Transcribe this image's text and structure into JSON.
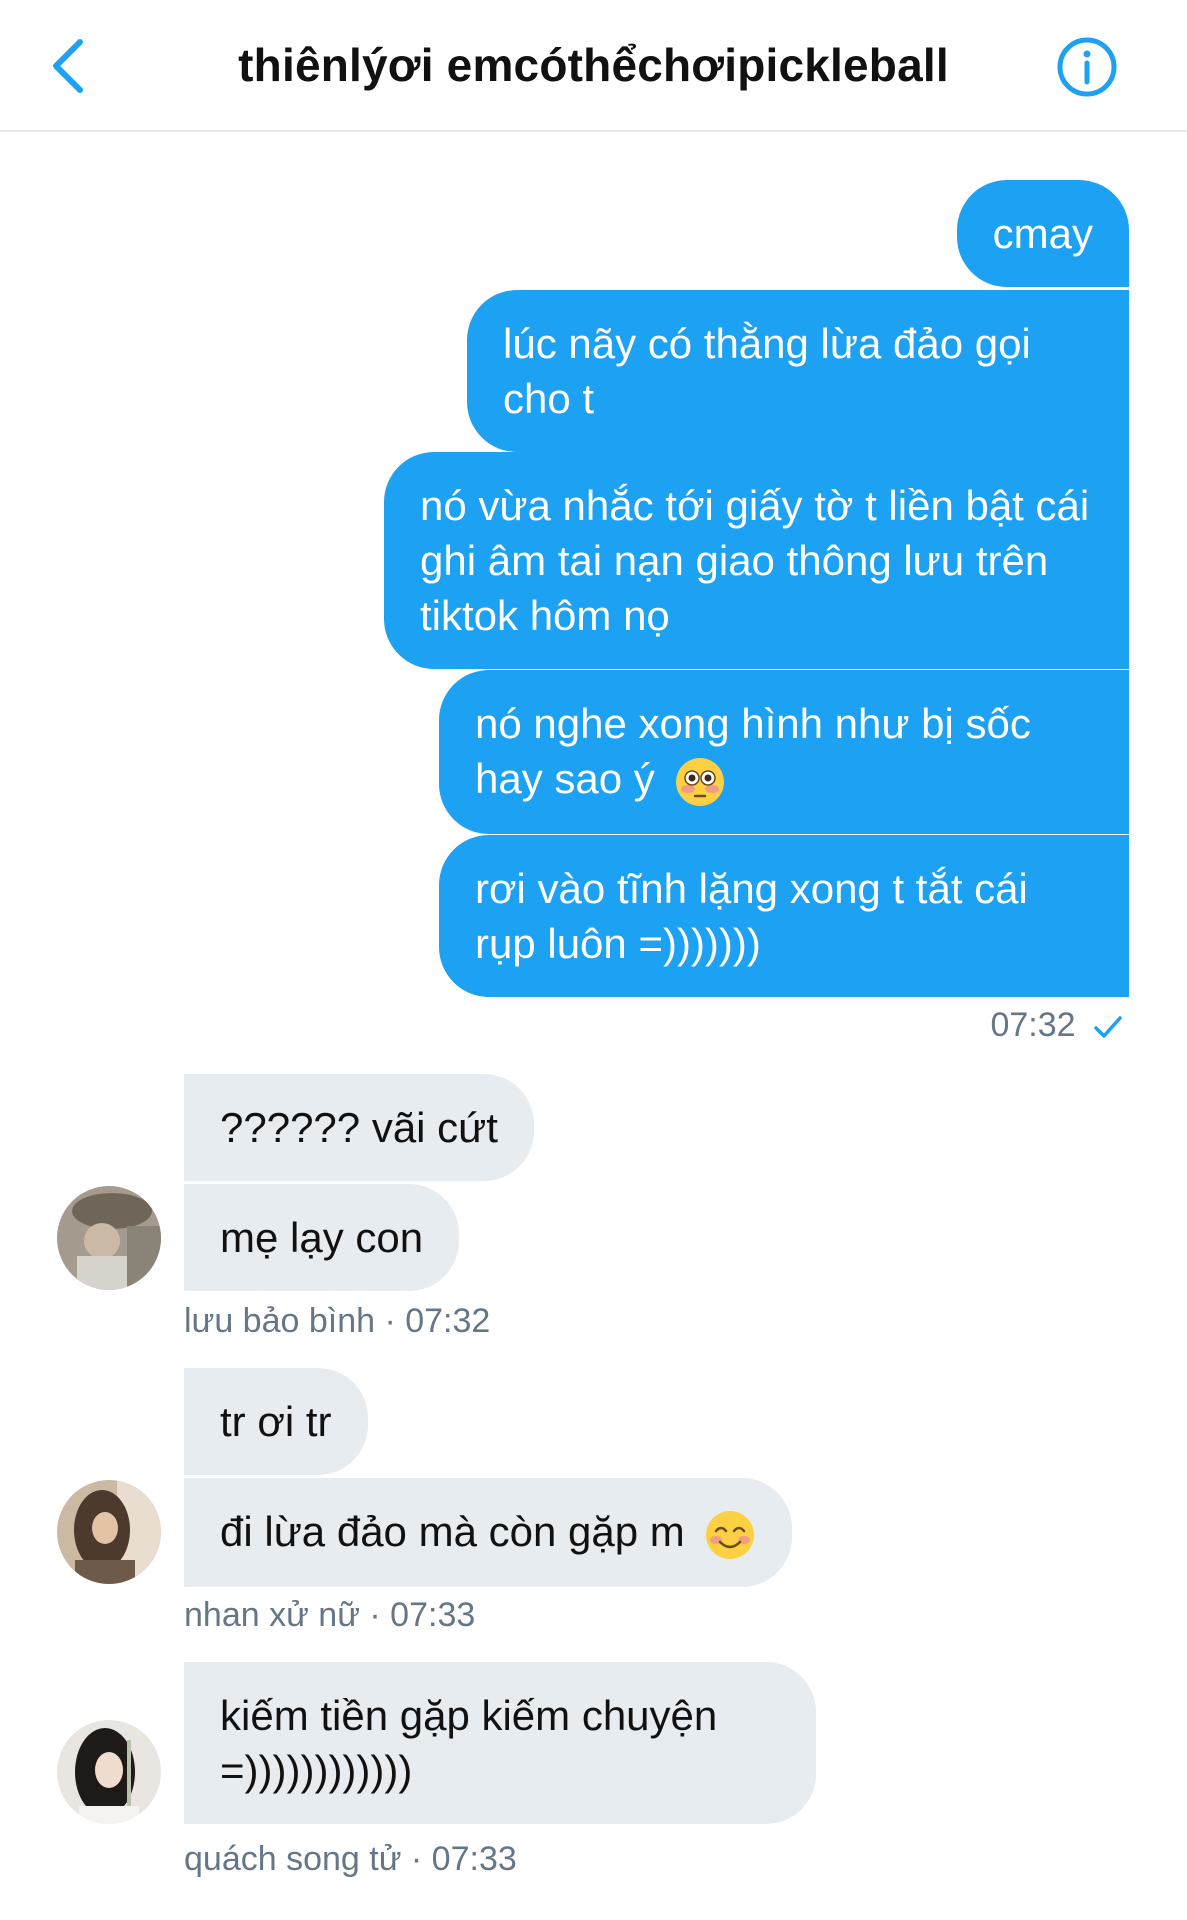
{
  "header": {
    "title": "thiênlýơi emcóthểchơipickleball",
    "back_icon": "chevron-left-icon",
    "info_icon": "info-icon"
  },
  "colors": {
    "accent": "#1da1f2",
    "incoming_bubble": "#e6ecf0",
    "meta_text": "#657786"
  },
  "outgoing": {
    "messages": [
      "cmay",
      "lúc nãy có thằng lừa đảo gọi cho t",
      "nó vừa nhắc tới giấy tờ t liền bật cái ghi âm tai nạn giao thông lưu trên tiktok hôm nọ",
      "nó nghe xong hình như bị sốc hay sao ý",
      "rơi vào tĩnh lặng xong t tắt cái rụp luôn =)))))))"
    ],
    "time": "07:32",
    "emoji_flushed": "flushed-face-emoji"
  },
  "group1": {
    "messages": [
      "?????? vãi cứt",
      "mẹ lạy con"
    ],
    "meta": "lưu bảo bình · 07:32"
  },
  "group2": {
    "messages": [
      "tr ơi tr",
      "đi lừa đảo mà còn gặp m"
    ],
    "meta": "nhan xử nữ · 07:33",
    "emoji_smile": "smiling-face-emoji"
  },
  "group3": {
    "messages": [
      "kiếm tiền gặp kiếm chuyện =))))))))))))"
    ],
    "meta": "quách song tử · 07:33"
  }
}
